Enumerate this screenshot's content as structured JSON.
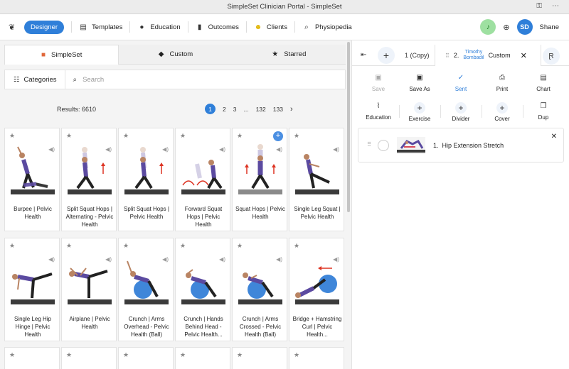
{
  "window": {
    "title": "SimpleSet Clinician Portal - SimpleSet"
  },
  "nav": {
    "designer": "Designer",
    "items": [
      {
        "label": "Templates",
        "icon": "file-icon"
      },
      {
        "label": "Education",
        "icon": "apple-icon"
      },
      {
        "label": "Outcomes",
        "icon": "bar-chart-icon"
      },
      {
        "label": "Clients",
        "icon": "smiley-icon"
      },
      {
        "label": "Physiopedia",
        "icon": "search-icon"
      }
    ],
    "user": {
      "initials": "SD",
      "name": "Shane"
    }
  },
  "library": {
    "tabs": [
      {
        "label": "SimpleSet",
        "icon": "cube-icon"
      },
      {
        "label": "Custom",
        "icon": "tag-icon"
      },
      {
        "label": "Starred",
        "icon": "star-icon"
      }
    ],
    "categories_label": "Categories",
    "search_placeholder": "Search",
    "results": "Results: 6610",
    "pager": {
      "pages": [
        "1",
        "2",
        "3",
        "...",
        "132",
        "133"
      ],
      "current": "1",
      "next": "›"
    },
    "cards": [
      {
        "label": "Burpee | Pelvic Health"
      },
      {
        "label": "Split Squat Hops | Alternating - Pelvic Health"
      },
      {
        "label": "Split Squat Hops | Pelvic Health"
      },
      {
        "label": "Forward Squat Hops | Pelvic Health"
      },
      {
        "label": "Squat Hops | Pelvic Health"
      },
      {
        "label": "Single Leg Squat | Pelvic Health"
      },
      {
        "label": "Single Leg Hip Hinge | Pelvic Health"
      },
      {
        "label": "Airplane | Pelvic Health"
      },
      {
        "label": "Crunch | Arms Overhead - Pelvic Health (Ball)"
      },
      {
        "label": "Crunch | Hands Behind Head - Pelvic Health..."
      },
      {
        "label": "Crunch | Arms Crossed - Pelvic Health (Ball)"
      },
      {
        "label": "Bridge + Hamstring Curl | Pelvic Health..."
      }
    ]
  },
  "program": {
    "tab_copy": "1 (Copy)",
    "active_tab": {
      "number": "2.",
      "client_first": "Timothy",
      "client_last": "Bombadil",
      "type": "Custom"
    },
    "tools": [
      {
        "label": "Save",
        "icon": "save-icon",
        "state": "disabled"
      },
      {
        "label": "Save As",
        "icon": "save-icon",
        "state": "normal"
      },
      {
        "label": "Sent",
        "icon": "check-icon",
        "state": "active"
      },
      {
        "label": "Print",
        "icon": "printer-icon",
        "state": "normal"
      },
      {
        "label": "Chart",
        "icon": "clipboard-icon",
        "state": "normal"
      },
      {
        "label": "Education",
        "icon": "paperclip-icon",
        "state": "normal"
      },
      {
        "label": "Exercise",
        "icon": "plus-icon",
        "state": "normal"
      },
      {
        "label": "Divider",
        "icon": "plus-icon",
        "state": "normal"
      },
      {
        "label": "Cover",
        "icon": "plus-icon",
        "state": "normal"
      },
      {
        "label": "Dup",
        "icon": "copy-icon",
        "state": "normal"
      }
    ],
    "exercises": [
      {
        "number": "1.",
        "name": "Hip Extension Stretch"
      }
    ]
  },
  "colors": {
    "accent": "#2f7fd9",
    "bell": "#9ee0a1",
    "mat": "#3b3b3b",
    "shirt": "#5b4aa0",
    "ball": "#3f86d9"
  }
}
